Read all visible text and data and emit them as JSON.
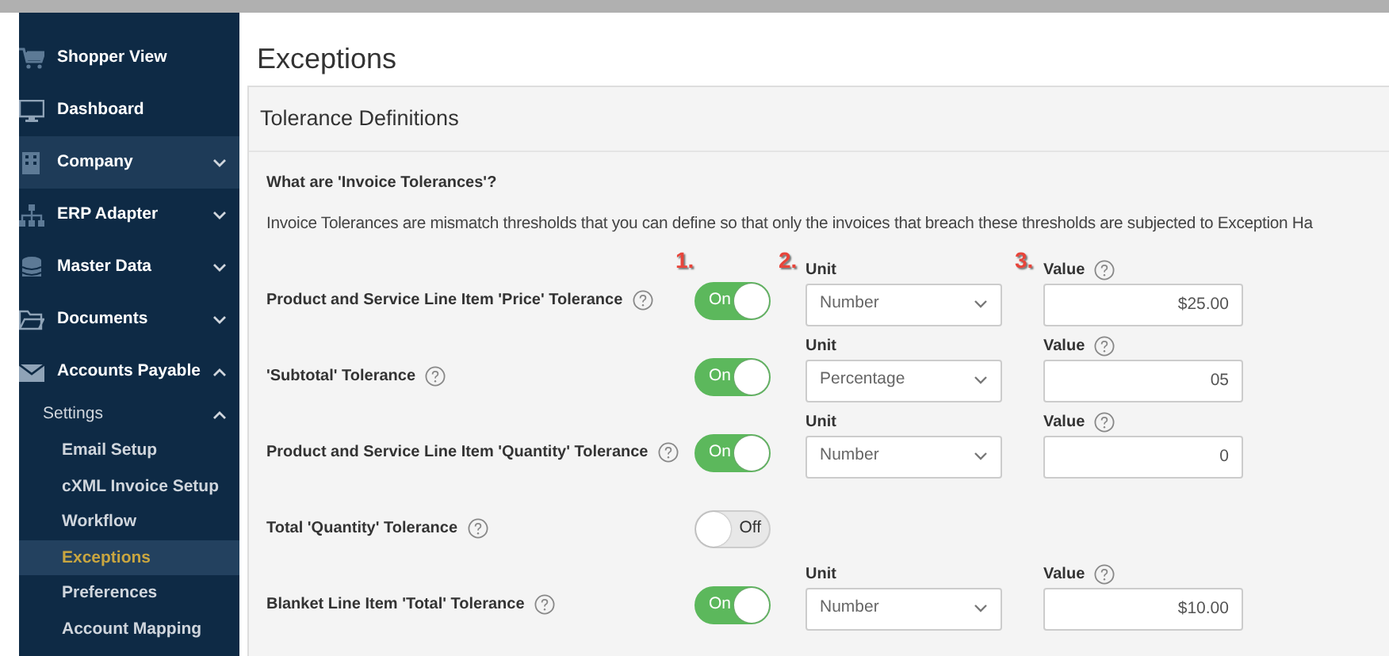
{
  "sidebar": {
    "items": [
      {
        "label": "Shopper View",
        "kind": "link",
        "hovered": false
      },
      {
        "label": "Dashboard",
        "kind": "link",
        "hovered": false
      },
      {
        "label": "Company",
        "kind": "group",
        "expanded": false,
        "hovered": true
      },
      {
        "label": "ERP Adapter",
        "kind": "group",
        "expanded": false,
        "hovered": false
      },
      {
        "label": "Master Data",
        "kind": "group",
        "expanded": false,
        "hovered": false
      },
      {
        "label": "Documents",
        "kind": "group",
        "expanded": false,
        "hovered": false
      },
      {
        "label": "Accounts Payable",
        "kind": "group",
        "expanded": true,
        "hovered": false,
        "children": [
          {
            "label": "Settings",
            "expanded": true,
            "children": [
              {
                "label": "Email Setup",
                "selected": false
              },
              {
                "label": "cXML Invoice Setup",
                "selected": false
              },
              {
                "label": "Workflow",
                "selected": false
              },
              {
                "label": "Exceptions",
                "selected": true
              },
              {
                "label": "Preferences",
                "selected": false
              },
              {
                "label": "Account Mapping",
                "selected": false
              }
            ]
          }
        ]
      }
    ]
  },
  "page_title": "Exceptions",
  "panel": {
    "title": "Tolerance Definitions",
    "question": "What are 'Invoice Tolerances'?",
    "description": "Invoice Tolerances are mismatch thresholds that you can define so that only the invoices that breach these thresholds are subjected to Exception Ha",
    "annotations": [
      "1.",
      "2.",
      "3."
    ],
    "rows": [
      {
        "label": "Product and Service Line Item 'Price' Tolerance",
        "on": true,
        "toggle_text": "On",
        "unit_label": "Unit",
        "unit": "Number",
        "value_label": "Value",
        "value": "$25.00"
      },
      {
        "label": "'Subtotal' Tolerance",
        "on": true,
        "toggle_text": "On",
        "unit_label": "Unit",
        "unit": "Percentage",
        "value_label": "Value",
        "value": "05"
      },
      {
        "label": "Product and Service Line Item 'Quantity' Tolerance",
        "on": true,
        "toggle_text": "On",
        "unit_label": "Unit",
        "unit": "Number",
        "value_label": "Value",
        "value": "0"
      },
      {
        "label": "Total 'Quantity' Tolerance",
        "on": false,
        "toggle_text": "Off"
      },
      {
        "label": "Blanket Line Item 'Total' Tolerance",
        "on": true,
        "toggle_text": "On",
        "unit_label": "Unit",
        "unit": "Number",
        "value_label": "Value",
        "value": "$10.00"
      }
    ]
  }
}
